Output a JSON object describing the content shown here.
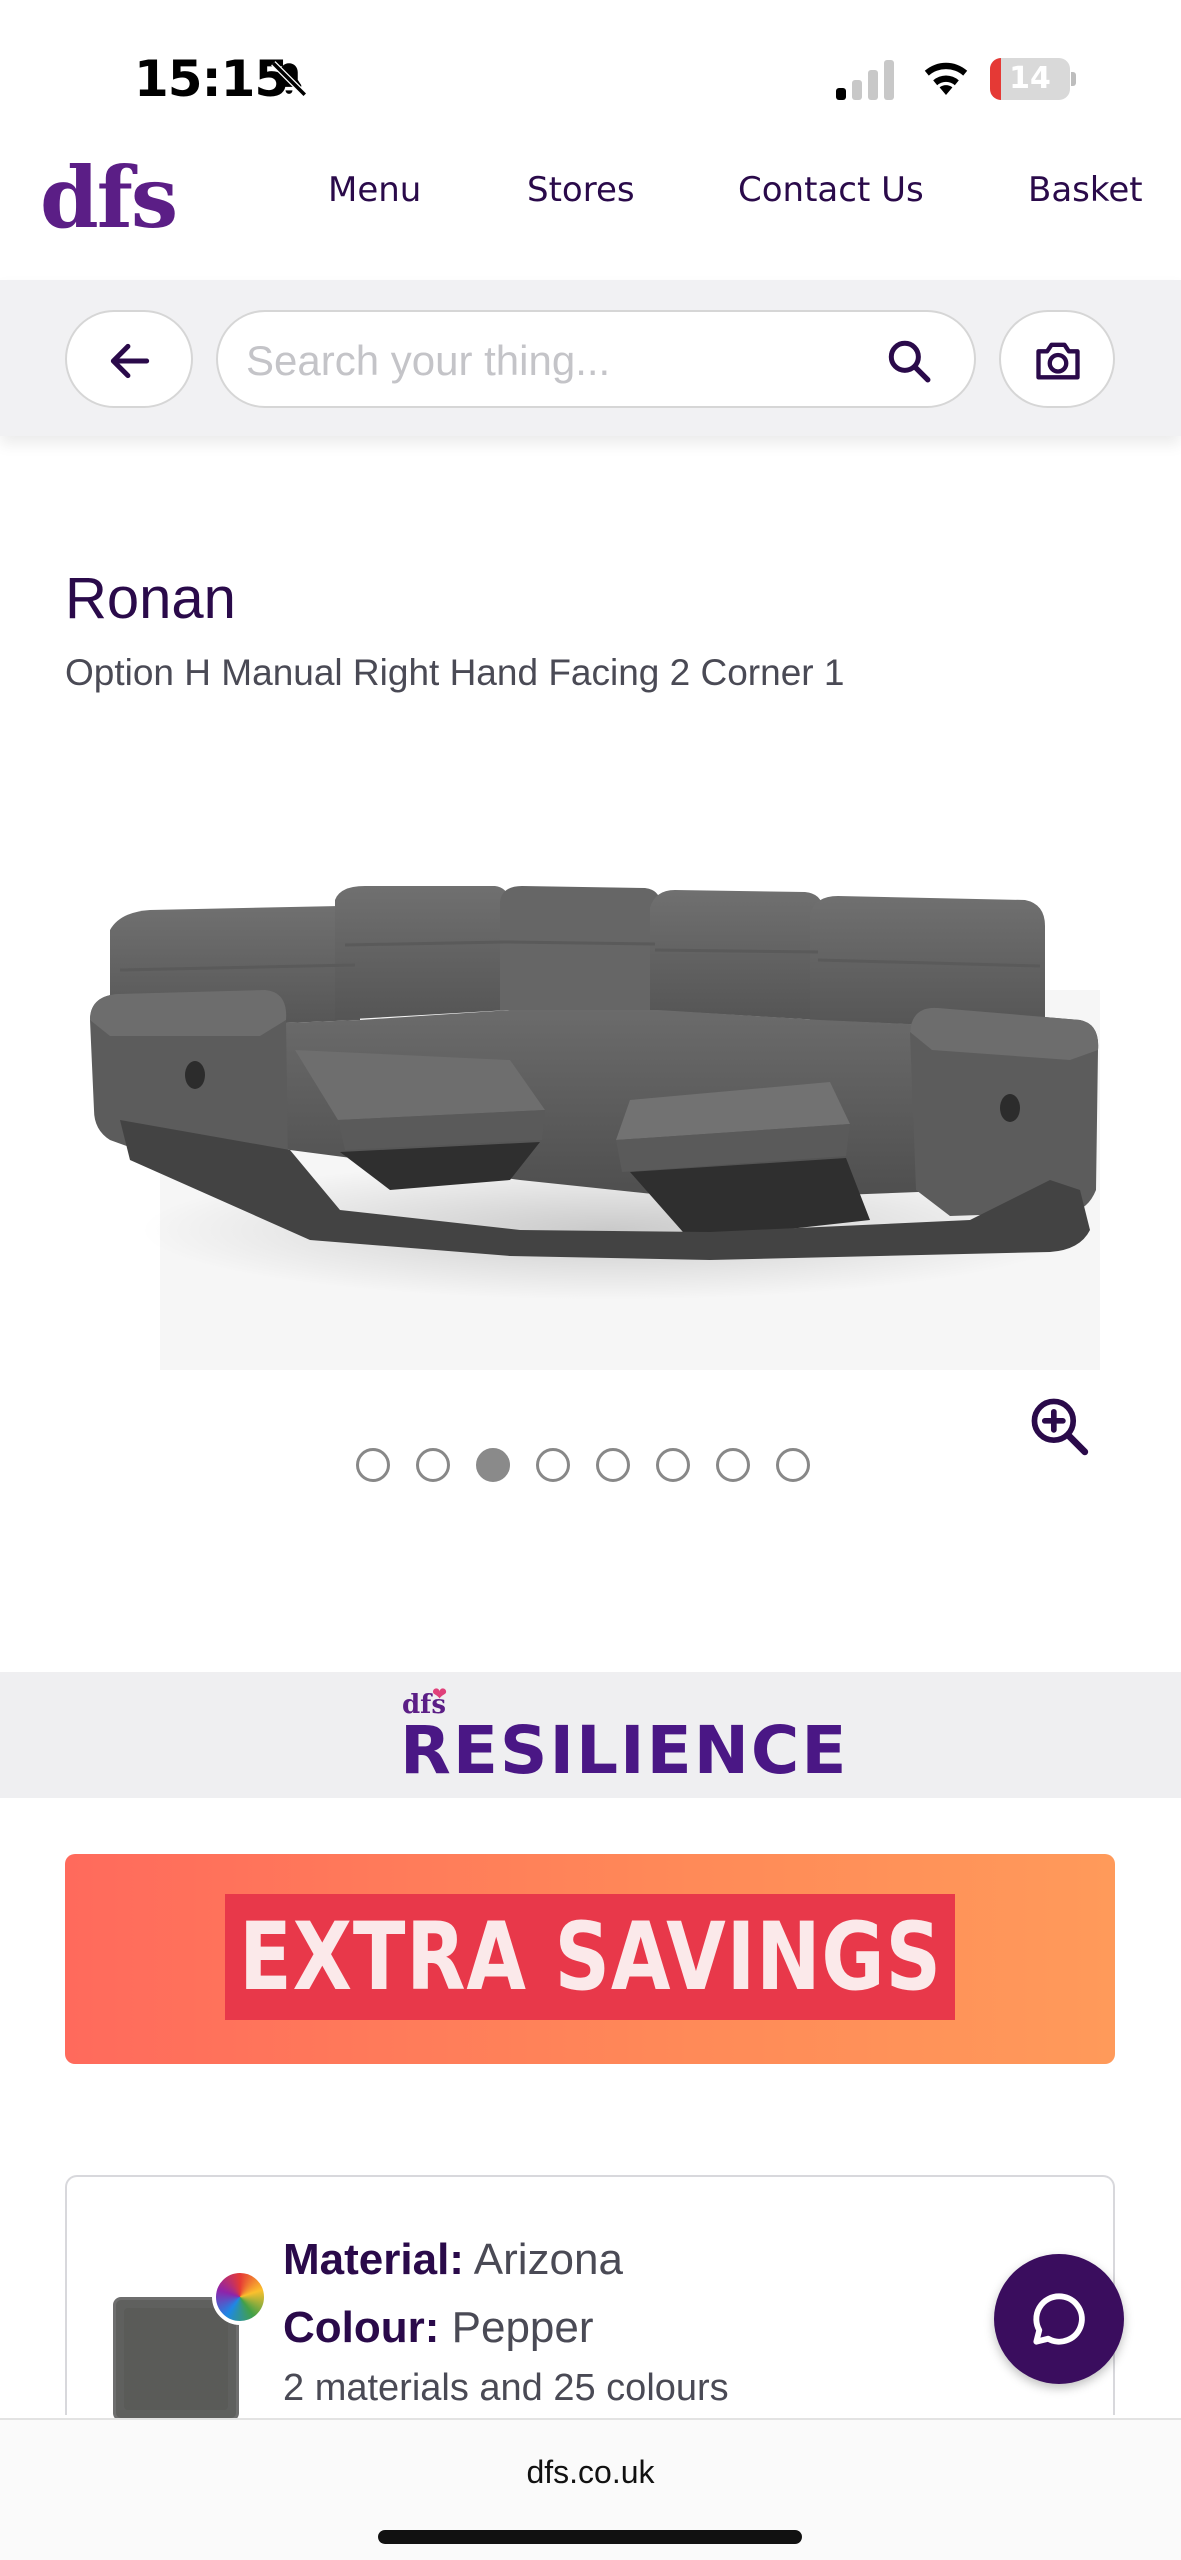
{
  "status_bar": {
    "time": "15:15",
    "battery_level": "14",
    "battery_fraction": 0.14,
    "icons": [
      "bell-slash-icon",
      "signal-icon",
      "wifi-icon",
      "battery-icon"
    ]
  },
  "nav": {
    "logo": "dfs",
    "links": [
      "Menu",
      "Stores",
      "Contact Us",
      "Basket"
    ]
  },
  "search": {
    "placeholder": "Search your thing...",
    "value": "",
    "icons": [
      "back-arrow-icon",
      "search-icon",
      "camera-icon"
    ]
  },
  "product": {
    "title": "Ronan",
    "subtitle": "Option H Manual Right Hand Facing 2 Corner 1",
    "image_alt": "grey fabric corner sofa with reclining footrests",
    "carousel_total": 8,
    "carousel_active_index": 2
  },
  "brand_band": {
    "small": "dfs",
    "title": "RESILIENCE"
  },
  "promo": {
    "text": "EXTRA SAVINGS"
  },
  "material": {
    "material_label": "Material:",
    "material_value": "Arizona",
    "colour_label": "Colour:",
    "colour_value": "Pepper",
    "count_text": "2 materials and 25 colours",
    "swatch_color": "#5a5b58"
  },
  "footer": {
    "url": "dfs.co.uk"
  },
  "colors": {
    "brand_purple": "#5b1e86",
    "dark_purple": "#2a0a4a",
    "chat_bg": "#3a0d5e",
    "promo_orange": "#ff8a58",
    "promo_red": "#e8384a"
  }
}
